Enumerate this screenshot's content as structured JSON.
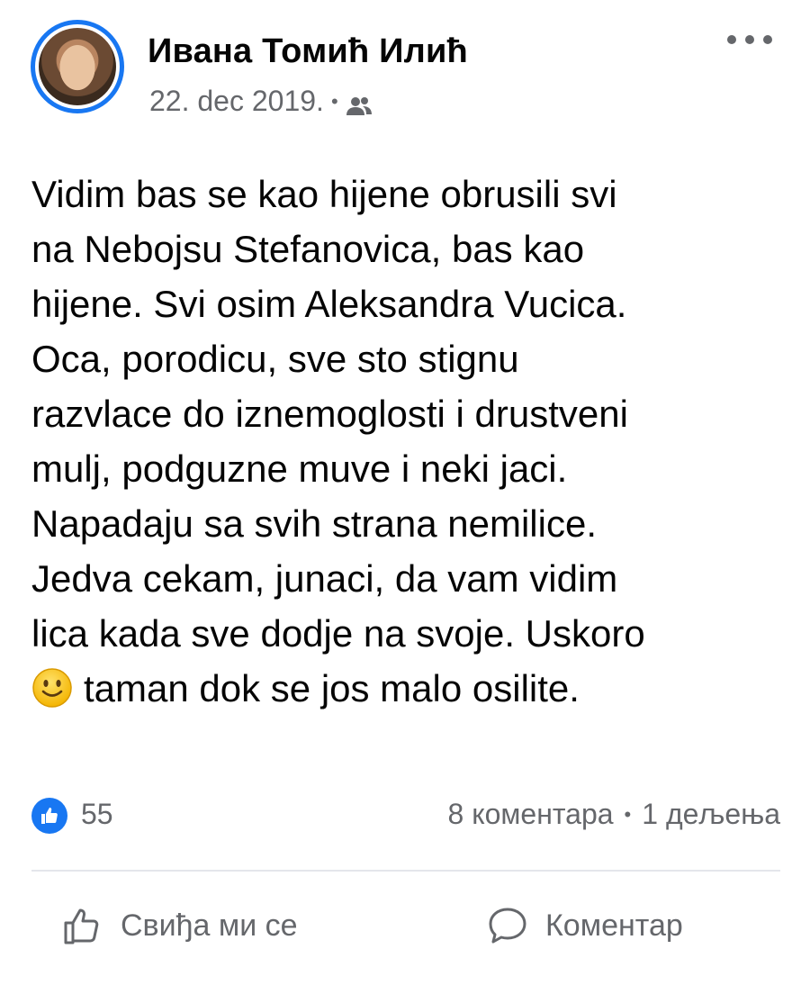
{
  "post": {
    "author": "Ивана Томић Илић",
    "date": "22. dec 2019.",
    "separator": "•",
    "audience_icon": "friends-icon",
    "more_icon": "more-icon",
    "text": "Vidim bas se kao hijene obrusili svi\nna Nebojsu Stefanovica, bas kao\nhijene. Svi osim Aleksandra Vucica.\nOca, porodicu, sve sto stignu\nrazvlace do iznemoglosti i drustveni\nmulj, podguzne muve i neki jaci.\nNapadaju sa svih strana nemilice.\nJedva cekam, junaci, da vam vidim\nlica kada sve dodje na svoje. Uskoro",
    "last_line_text": "taman dok se jos malo osilite.",
    "emoji": "slightly-smiling-face"
  },
  "stats": {
    "likes": "55",
    "comments": "8 коментара",
    "separator": "•",
    "shares": "1 дељења"
  },
  "actions": {
    "like_label": "Свиђа ми се",
    "comment_label": "Коментар"
  },
  "colors": {
    "accent": "#1877f2",
    "secondary_text": "#65676b",
    "divider": "#e4e6eb"
  }
}
